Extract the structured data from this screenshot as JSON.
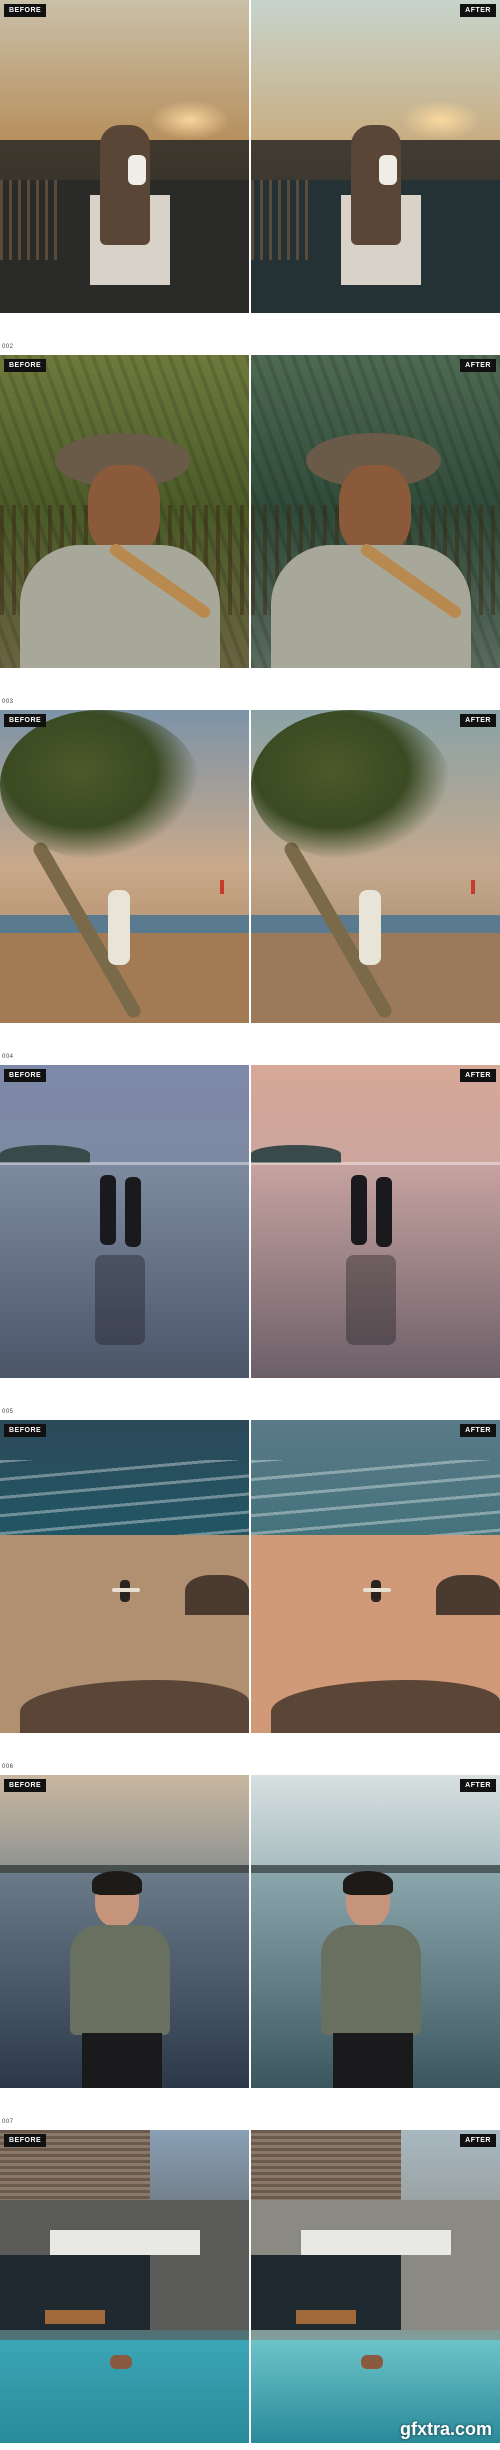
{
  "labels": {
    "before": "BEFORE",
    "after": "AFTER"
  },
  "sections": [
    {
      "number": "",
      "scene": "rooftop-couple-sunset",
      "before": {
        "top": "#c9c0a8",
        "mid": "#b58a55",
        "bottom": "#2a2a28"
      },
      "after": {
        "top": "#c7d4cc",
        "mid": "#c9a97a",
        "bottom": "#243236"
      }
    },
    {
      "number": "002",
      "scene": "farmer-portrait",
      "before": {
        "top": "#6e7a3c",
        "mid": "#4a5a28",
        "bottom": "#6a6440"
      },
      "after": {
        "top": "#4e6a52",
        "mid": "#2f4a38",
        "bottom": "#5a6a5c"
      }
    },
    {
      "number": "003",
      "scene": "beach-palm",
      "before": {
        "top": "#7c93a8",
        "mid": "#c9a98a",
        "bottom": "#a27a54"
      },
      "after": {
        "top": "#8aa2a6",
        "mid": "#c4a98e",
        "bottom": "#9a7a5a"
      }
    },
    {
      "number": "004",
      "scene": "beach-running",
      "before": {
        "top": "#7e88a8",
        "mid": "#7d8aa0",
        "bottom": "#4c5568"
      },
      "after": {
        "top": "#d6a898",
        "mid": "#c6a3a0",
        "bottom": "#6c5f68"
      }
    },
    {
      "number": "005",
      "scene": "coast-surfer",
      "before": {
        "top": "#2c4a5a",
        "mid": "#1d5a68",
        "bottom": "#b09070"
      },
      "after": {
        "top": "#5a7a88",
        "mid": "#3c7078",
        "bottom": "#d09a78"
      }
    },
    {
      "number": "006",
      "scene": "water-portrait",
      "before": {
        "top": "#c9b8a0",
        "mid": "#6a7a88",
        "bottom": "#2c3848"
      },
      "after": {
        "top": "#d8e0e0",
        "mid": "#8aa6ac",
        "bottom": "#3c5660"
      }
    },
    {
      "number": "007",
      "scene": "modern-pool-house",
      "before": {
        "top": "#8aa0b6",
        "mid": "#5a5a58",
        "bottom": "#3aa6b6"
      },
      "after": {
        "top": "#a8b8c0",
        "mid": "#8a8a82",
        "bottom": "#6cc4c8"
      }
    }
  ],
  "watermark": "gfxtra.com"
}
